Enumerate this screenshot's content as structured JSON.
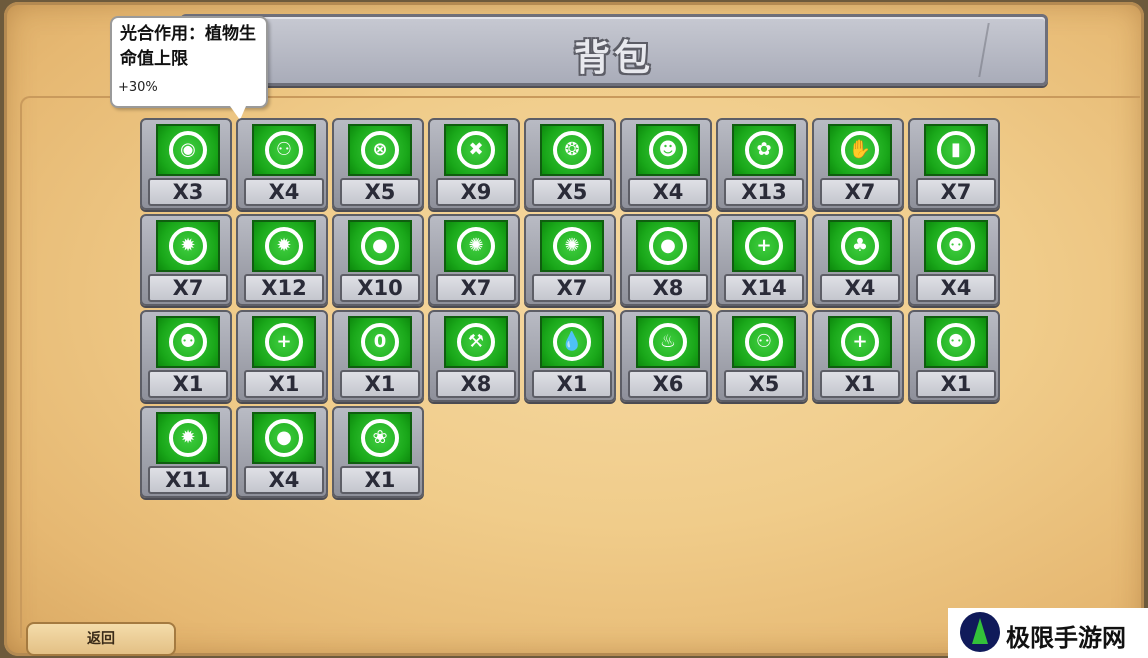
{
  "title": "背包",
  "tooltip": {
    "title": "光合作用：植物生命值上限",
    "value": "+30%"
  },
  "items": [
    {
      "icon": "pea-shooter-icon",
      "glyph": "◉",
      "count": "X3"
    },
    {
      "icon": "wallnut-plus-icon",
      "glyph": "⚇",
      "count": "X4"
    },
    {
      "icon": "target-icon",
      "glyph": "⊗",
      "count": "X5"
    },
    {
      "icon": "crosshair-x-icon",
      "glyph": "✖",
      "count": "X9"
    },
    {
      "icon": "pea-pod-icon",
      "glyph": "❂",
      "count": "X5"
    },
    {
      "icon": "zombie-head-icon",
      "glyph": "☻",
      "count": "X4"
    },
    {
      "icon": "cracked-egg-icon",
      "glyph": "✿",
      "count": "X13"
    },
    {
      "icon": "hand-minus-icon",
      "glyph": "✋",
      "count": "X7"
    },
    {
      "icon": "card-minus-icon",
      "glyph": "▮",
      "count": "X7"
    },
    {
      "icon": "sun-minus-icon",
      "glyph": "✹",
      "count": "X7"
    },
    {
      "icon": "sun-plus-icon",
      "glyph": "✹",
      "count": "X12"
    },
    {
      "icon": "bomb-plus-icon",
      "glyph": "●",
      "count": "X10"
    },
    {
      "icon": "chomper-plus-icon",
      "glyph": "✺",
      "count": "X7"
    },
    {
      "icon": "spiky-plus-icon",
      "glyph": "✺",
      "count": "X7"
    },
    {
      "icon": "cherry-plus-icon",
      "glyph": "●",
      "count": "X8"
    },
    {
      "icon": "heal-circle-icon",
      "glyph": "+",
      "count": "X14"
    },
    {
      "icon": "clover-icon",
      "glyph": "♣",
      "count": "X4"
    },
    {
      "icon": "teeth-ring-icon",
      "glyph": "⚉",
      "count": "X4"
    },
    {
      "icon": "teeth-ring-icon",
      "glyph": "⚉",
      "count": "X1"
    },
    {
      "icon": "plus-circle-icon",
      "glyph": "+",
      "count": "X1"
    },
    {
      "icon": "zero-circle-icon",
      "glyph": "0",
      "count": "X1"
    },
    {
      "icon": "hammer-minus-icon",
      "glyph": "⚒",
      "count": "X8"
    },
    {
      "icon": "water-drop-ring-icon",
      "glyph": "💧",
      "count": "X1"
    },
    {
      "icon": "fire-ring-icon",
      "glyph": "♨",
      "count": "X6"
    },
    {
      "icon": "eggs-plus-icon",
      "glyph": "⚇",
      "count": "X5"
    },
    {
      "icon": "plus-plus-circle-icon",
      "glyph": "+",
      "count": "X1"
    },
    {
      "icon": "flame-teeth-ring-icon",
      "glyph": "⚉",
      "count": "X1"
    },
    {
      "icon": "sun-ring-icon",
      "glyph": "✹",
      "count": "X11"
    },
    {
      "icon": "apple-plus-icon",
      "glyph": "●",
      "count": "X4"
    },
    {
      "icon": "gift-plant-icon",
      "glyph": "❀",
      "count": "X1"
    }
  ],
  "back_button": "返回",
  "watermark": "极限手游网",
  "colors": {
    "item_green": "#1aa81a",
    "panel_bg": "#f0cc8a",
    "banner_gray": "#b7bac5"
  }
}
